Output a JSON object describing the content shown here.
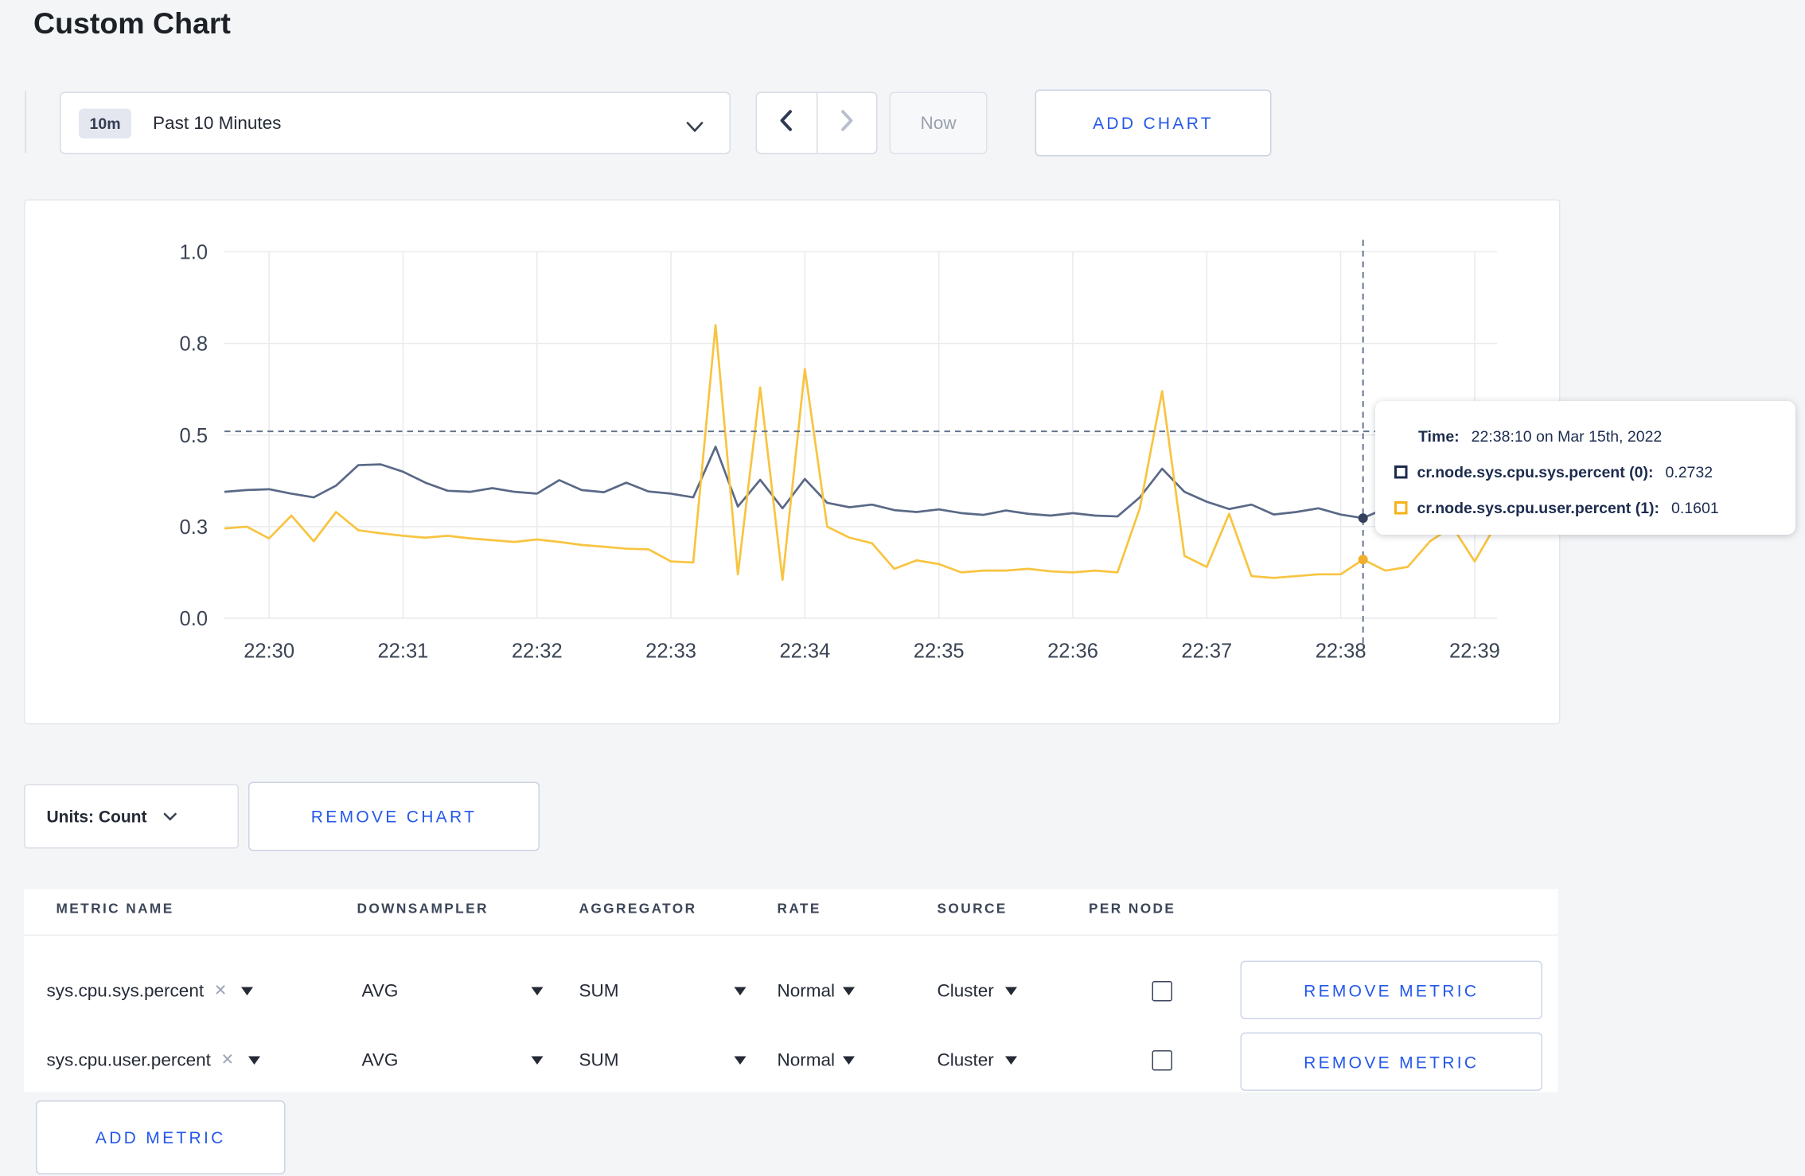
{
  "page": {
    "title": "Custom Chart"
  },
  "colors": {
    "accent_blue": "#2458e8",
    "text_dark": "#242a35",
    "series_sys": "#5a6987",
    "series_user": "#f8c440"
  },
  "toolbar": {
    "time_window_badge": "10m",
    "time_window_label": "Past 10 Minutes",
    "now_label": "Now",
    "add_chart_label": "ADD CHART"
  },
  "chart_controls": {
    "units_label": "Units: Count",
    "remove_chart_label": "REMOVE CHART"
  },
  "tooltip": {
    "time_key": "Time:",
    "time_value": "22:38:10 on Mar 15th, 2022",
    "series": [
      {
        "label": "cr.node.sys.cpu.sys.percent (0):",
        "value": "0.2732",
        "color": "#1f2b4d"
      },
      {
        "label": "cr.node.sys.cpu.user.percent (1):",
        "value": "0.1601",
        "color": "#f6b218"
      }
    ]
  },
  "chart_data": {
    "type": "line",
    "title": "",
    "xlabel": "",
    "ylabel": "",
    "ylim": [
      0,
      1
    ],
    "grid": true,
    "legend_position": "none",
    "x_start_label": "22:29:40",
    "x_interval_seconds": 10,
    "x_total_seconds": 570,
    "y_ticks": [
      {
        "value": 0,
        "label": "0.0"
      },
      {
        "value": 0.25,
        "label": "0.3"
      },
      {
        "value": 0.5,
        "label": "0.5"
      },
      {
        "value": 0.75,
        "label": "0.8"
      },
      {
        "value": 1,
        "label": "1.0"
      }
    ],
    "x_ticks": [
      {
        "offset_s": 20,
        "label": "22:30"
      },
      {
        "offset_s": 80,
        "label": "22:31"
      },
      {
        "offset_s": 140,
        "label": "22:32"
      },
      {
        "offset_s": 200,
        "label": "22:33"
      },
      {
        "offset_s": 260,
        "label": "22:34"
      },
      {
        "offset_s": 320,
        "label": "22:35"
      },
      {
        "offset_s": 380,
        "label": "22:36"
      },
      {
        "offset_s": 440,
        "label": "22:37"
      },
      {
        "offset_s": 500,
        "label": "22:38"
      },
      {
        "offset_s": 560,
        "label": "22:39"
      }
    ],
    "series": [
      {
        "name": "cr.node.sys.cpu.sys.percent",
        "color": "#5a6987",
        "values": [
          0.345,
          0.35,
          0.352,
          0.34,
          0.33,
          0.362,
          0.418,
          0.42,
          0.4,
          0.37,
          0.348,
          0.345,
          0.355,
          0.345,
          0.34,
          0.377,
          0.35,
          0.344,
          0.37,
          0.346,
          0.34,
          0.33,
          0.468,
          0.305,
          0.378,
          0.3,
          0.38,
          0.315,
          0.303,
          0.31,
          0.295,
          0.29,
          0.297,
          0.287,
          0.282,
          0.294,
          0.285,
          0.28,
          0.287,
          0.28,
          0.278,
          0.33,
          0.408,
          0.345,
          0.318,
          0.298,
          0.31,
          0.283,
          0.29,
          0.3,
          0.283,
          0.2732,
          0.3,
          0.29,
          0.31,
          0.3,
          0.3,
          0.31
        ]
      },
      {
        "name": "cr.node.sys.cpu.user.percent",
        "color": "#f8c440",
        "values": [
          0.245,
          0.25,
          0.218,
          0.28,
          0.21,
          0.29,
          0.24,
          0.232,
          0.225,
          0.22,
          0.225,
          0.218,
          0.213,
          0.208,
          0.215,
          0.208,
          0.2,
          0.195,
          0.19,
          0.188,
          0.155,
          0.152,
          0.8,
          0.12,
          0.63,
          0.105,
          0.68,
          0.25,
          0.22,
          0.205,
          0.135,
          0.158,
          0.148,
          0.125,
          0.13,
          0.13,
          0.135,
          0.128,
          0.125,
          0.13,
          0.125,
          0.3,
          0.62,
          0.17,
          0.14,
          0.285,
          0.115,
          0.11,
          0.115,
          0.12,
          0.12,
          0.1601,
          0.13,
          0.14,
          0.21,
          0.25,
          0.155,
          0.26
        ]
      }
    ],
    "crosshair": {
      "x_offset_s": 510,
      "x_time": "22:38:10",
      "y_value": 0.51
    },
    "hover_points": [
      {
        "x_offset_s": 510,
        "value": 0.2732,
        "color": "#33415e"
      },
      {
        "x_offset_s": 510,
        "value": 0.1601,
        "color": "#f0ae2a"
      }
    ]
  },
  "metrics_table": {
    "headers": [
      "METRIC NAME",
      "DOWNSAMPLER",
      "AGGREGATOR",
      "RATE",
      "SOURCE",
      "PER NODE"
    ],
    "clear_glyph": "×",
    "rows": [
      {
        "metric": "sys.cpu.sys.percent",
        "downsampler": "AVG",
        "aggregator": "SUM",
        "rate": "Normal",
        "source": "Cluster",
        "per_node_checked": false,
        "remove_label": "REMOVE METRIC"
      },
      {
        "metric": "sys.cpu.user.percent",
        "downsampler": "AVG",
        "aggregator": "SUM",
        "rate": "Normal",
        "source": "Cluster",
        "per_node_checked": false,
        "remove_label": "REMOVE METRIC"
      }
    ],
    "add_metric_label": "ADD METRIC"
  }
}
